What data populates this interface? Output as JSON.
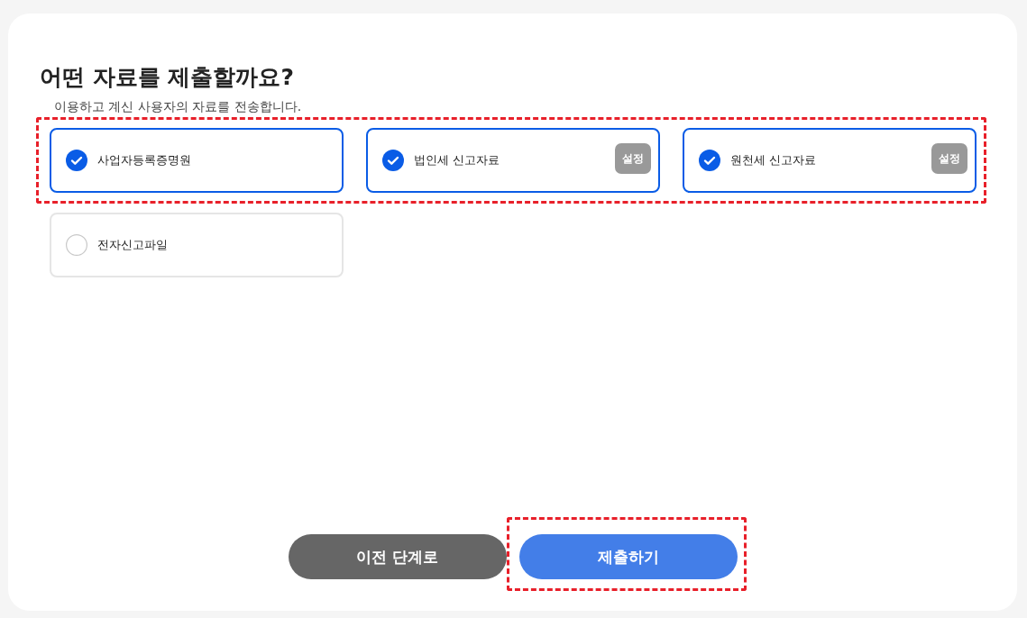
{
  "title": "어떤 자료를 제출할까요?",
  "subtitle": "이용하고 계신 사용자의 자료를 전송합니다.",
  "option_rows": [
    {
      "highlighted": true,
      "options": [
        {
          "label": "사업자등록증명원",
          "checked": true
        },
        {
          "label": "법인세 신고자료",
          "checked": true,
          "action": "설정"
        },
        {
          "label": "원천세 신고자료",
          "checked": true,
          "action": "설정"
        }
      ]
    },
    {
      "highlighted": false,
      "options": [
        {
          "label": "전자신고파일",
          "checked": false
        }
      ]
    }
  ],
  "buttons": [
    {
      "label": "이전 단계로",
      "kind": "secondary",
      "highlighted": false
    },
    {
      "label": "제출하기",
      "kind": "primary",
      "highlighted": true
    }
  ]
}
